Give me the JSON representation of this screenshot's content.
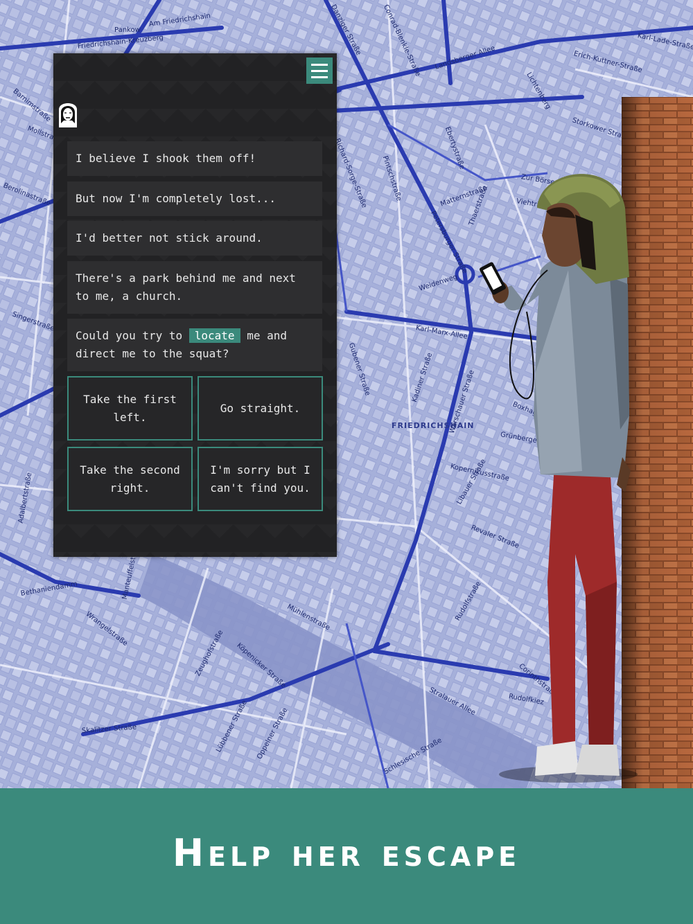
{
  "map": {
    "district_labels": [
      "FRIEDRICHSHAIN"
    ],
    "street_labels": [
      "Am Friedrichshain",
      "Pankow",
      "Friedrichshain-Kreuzberg",
      "Danziger Straße",
      "Conrad-Blenkle-Straße",
      "Landsberger Allee",
      "Karl-Lade-Straße",
      "Erich-Kuttner-Straße",
      "Lichtenberg",
      "Storkower Straße",
      "Barnimstraße",
      "Mollstraße",
      "Berolinastraße",
      "Singerstraße",
      "Richard-Sorge-Straße",
      "Pintschstraße",
      "Ebertystraße",
      "Petersburger Straße",
      "Matternstraße",
      "Thaerstraße",
      "Weidenweg",
      "Karl-Marx-Allee",
      "Gubener Straße",
      "Kadiner Straße",
      "Warschauer Straße",
      "Boxhagener Straße",
      "Grünberger Straße",
      "Kopernikusstraße",
      "Libauer Straße",
      "Revaler Straße",
      "Mühlenstraße",
      "Köpenicker Straße",
      "Wrangelstraße",
      "Skalitzer Straße",
      "Stralauer Allee",
      "Rudolfstraße",
      "Bethaniendamm",
      "Adalbertstraße",
      "Manteuffelstraße",
      "Zeughofstraße",
      "Lübbener Straße",
      "Oppelner Straße",
      "Rudolfkiez",
      "Corinthstraße",
      "Schlesische Straße",
      "Viehtrift",
      "Zur Börse"
    ]
  },
  "chat": {
    "menu_icon": "hamburger-icon",
    "avatar_icon": "girl-avatar-icon",
    "messages": [
      "I believe I shook them off!",
      "But now I'm completely lost...",
      "I'd better not stick around.",
      "There's a park behind me and next to me, a church."
    ],
    "last_message": {
      "before": "Could you try to ",
      "keyword": "locate",
      "after": " me and direct me to the squat?"
    },
    "choices": [
      "Take the first left.",
      "Go straight.",
      "Take the second right.",
      "I'm sorry but I can't find you."
    ]
  },
  "banner": {
    "text": "Help her escape"
  },
  "colors": {
    "accent": "#3b8a7c",
    "panel": "#222224",
    "bubble": "#2e2e30",
    "map": "#a9b3dc",
    "road": "#2a3bb0"
  }
}
